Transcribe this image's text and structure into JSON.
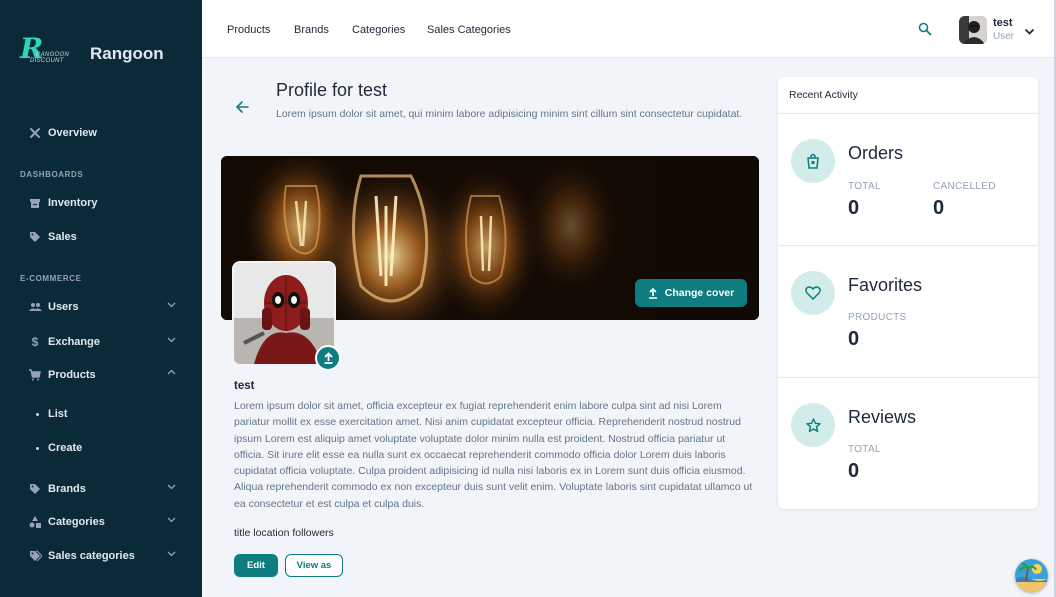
{
  "brand": {
    "name": "Rangoon",
    "logo_text_1": "RANGOON",
    "logo_text_2": "DISCOUNT"
  },
  "sidebar": {
    "overview": "Overview",
    "section_dashboards": "DASHBOARDS",
    "inventory": "Inventory",
    "sales": "Sales",
    "section_ecommerce": "E-COMMERCE",
    "users": "Users",
    "exchange": "Exchange",
    "products": "Products",
    "list": "List",
    "create": "Create",
    "brands": "Brands",
    "categories": "Categories",
    "sales_categories": "Sales categories"
  },
  "topbar": {
    "nav": [
      "Products",
      "Brands",
      "Categories",
      "Sales Categories"
    ],
    "user_name": "test",
    "user_role": "User"
  },
  "header": {
    "title": "Profile for test",
    "subtitle": "Lorem ipsum dolor sit amet, qui minim labore adipisicing minim sint cillum sint consectetur cupidatat."
  },
  "cover": {
    "change_label": "Change cover"
  },
  "profile": {
    "name": "test",
    "bio": "Lorem ipsum dolor sit amet, officia excepteur ex fugiat reprehenderit enim labore culpa sint ad nisi Lorem pariatur mollit ex esse exercitation amet. Nisi anim cupidatat excepteur officia. Reprehenderit nostrud nostrud ipsum Lorem est aliquip amet voluptate voluptate dolor minim nulla est proident. Nostrud officia pariatur ut officia. Sit irure elit esse ea nulla sunt ex occaecat reprehenderit commodo officia dolor Lorem duis laboris cupidatat officia voluptate. Culpa proident adipisicing id nulla nisi laboris ex in Lorem sunt duis officia eiusmod. Aliqua reprehenderit commodo ex non excepteur duis sunt velit enim. Voluptate laboris sint cupidatat ullamco ut ea consectetur et est culpa et culpa duis.",
    "meta": "title location followers",
    "edit_label": "Edit",
    "view_label": "View as"
  },
  "activity": {
    "title": "Recent Activity",
    "orders": {
      "title": "Orders",
      "total_label": "TOTAL",
      "total": "0",
      "cancelled_label": "CANCELLED",
      "cancelled": "0"
    },
    "favorites": {
      "title": "Favorites",
      "products_label": "PRODUCTS",
      "products": "0"
    },
    "reviews": {
      "title": "Reviews",
      "total_label": "TOTAL",
      "total": "0"
    }
  },
  "colors": {
    "sidebar_bg": "#0b2a38",
    "accent": "#0f7c7f",
    "accent_light": "#d1ece9",
    "page_bg": "#f1f5f9"
  }
}
